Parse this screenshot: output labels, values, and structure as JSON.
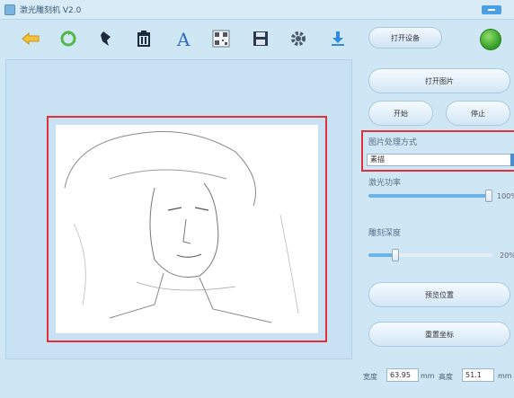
{
  "window": {
    "title": "激光雕刻机 V2.0"
  },
  "toolbar": {
    "icons": [
      "back-icon",
      "refresh-icon",
      "pen-icon",
      "delete-icon",
      "text-icon",
      "qr-icon",
      "save-icon",
      "gear-icon",
      "download-icon"
    ]
  },
  "device": {
    "open_label": "打开设备",
    "status_color": "#3aa82e"
  },
  "panel": {
    "open_image_label": "打开图片",
    "start_label": "开始",
    "stop_label": "停止",
    "method_label": "图片处理方式",
    "method_value": "素描",
    "laser_power_label": "激光功率",
    "laser_power_value": "100%",
    "laser_power_fraction": 0.97,
    "burn_depth_label": "雕刻深度",
    "burn_depth_value": "20%",
    "burn_depth_fraction": 0.2,
    "preview_position_label": "预览位置",
    "reset_coords_label": "重置坐标",
    "width_label": "宽度",
    "width_value": "63.95",
    "width_unit": "mm",
    "height_label": "高度",
    "height_value": "51.1",
    "height_unit": "mm"
  },
  "colors": {
    "accent": "#4aa0e2",
    "highlight": "#e0303a"
  }
}
